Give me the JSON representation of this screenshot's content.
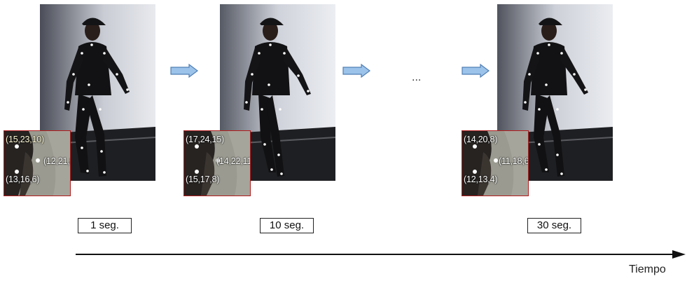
{
  "frames": [
    {
      "time_label": "1 seg.",
      "coords": [
        "(15,23,10)",
        "(12,21,8)",
        "(13,16,6)"
      ]
    },
    {
      "time_label": "10 seg.",
      "coords": [
        "(17,24,15)",
        "(14,22,11)",
        "(15,17,8)"
      ]
    },
    {
      "time_label": "30 seg.",
      "coords": [
        "(14,20,8)",
        "(11,18,6)",
        "(12,13,4)"
      ]
    }
  ],
  "ellipsis": "...",
  "axis_label": "Tiempo",
  "colors": {
    "arrow_fill": "#9cc3ea",
    "arrow_stroke": "#4f7fb5",
    "inset_border": "#b21c1c"
  }
}
